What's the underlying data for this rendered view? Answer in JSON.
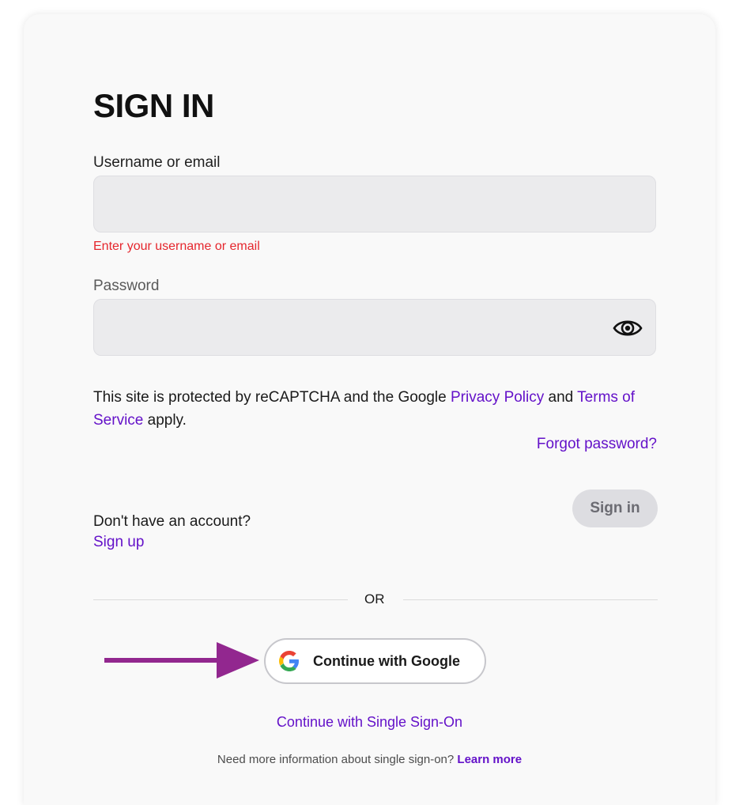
{
  "title": "SIGN IN",
  "username": {
    "label": "Username or email",
    "value": "",
    "error": "Enter your username or email"
  },
  "password": {
    "label": "Password",
    "value": "",
    "toggle_icon": "eye-icon"
  },
  "legal": {
    "prefix": "This site is protected by reCAPTCHA and the Google ",
    "privacy_link": "Privacy Policy",
    "middle": " and ",
    "terms_link": "Terms of Service",
    "suffix": " apply."
  },
  "forgot_password": "Forgot password?",
  "signup": {
    "prompt": "Don't have an account?",
    "link": "Sign up"
  },
  "signin_button": "Sign in",
  "divider_text": "OR",
  "google_button": {
    "label": "Continue with Google",
    "icon": "google-icon"
  },
  "annotation_arrow_color": "#92278f",
  "sso_link": "Continue with Single Sign-On",
  "sso_info": {
    "text": "Need more information about single sign-on?",
    "link": "Learn more"
  },
  "colors": {
    "link": "#6412c9",
    "error": "#e5262d",
    "card_bg": "#f9f9f9",
    "input_bg": "#ebebed",
    "disabled_button_bg": "#dddde1"
  }
}
